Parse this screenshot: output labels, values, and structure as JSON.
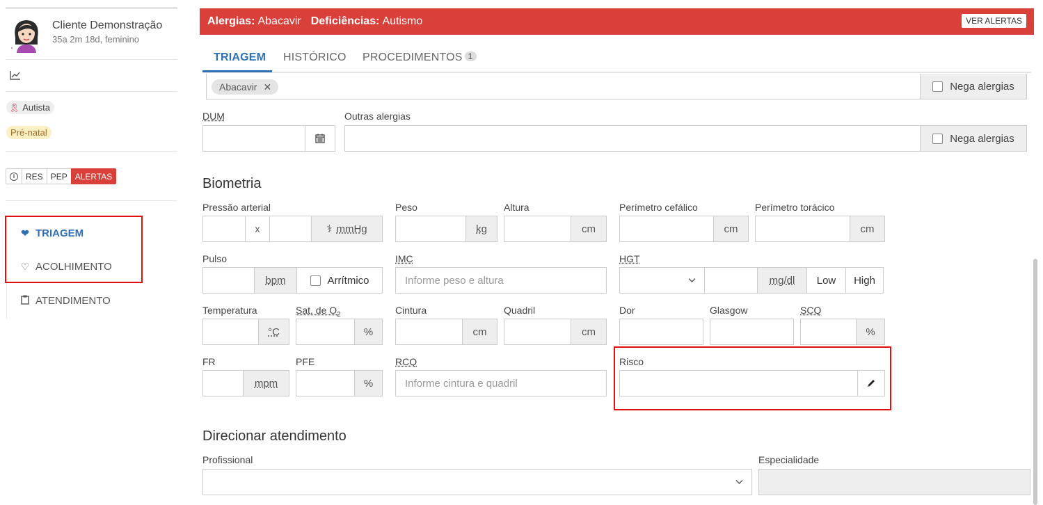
{
  "patient": {
    "name": "Cliente Demonstração",
    "meta": "35a 2m 18d, feminino"
  },
  "sidebar": {
    "tags": {
      "autista": "Autista",
      "prenatal": "Pré-natal"
    },
    "buttons": {
      "info": "i",
      "res": "RES",
      "pep": "PEP",
      "alertas": "ALERTAS"
    },
    "nav": [
      {
        "label": "TRIAGEM",
        "icon": "heartbeat-icon",
        "active": true
      },
      {
        "label": "ACOLHIMENTO",
        "icon": "heart-outline-icon"
      },
      {
        "label": "ATENDIMENTO",
        "icon": "clipboard-icon"
      }
    ]
  },
  "alert": {
    "alergias_label": "Alergias:",
    "alergias_value": "Abacavir",
    "deficiencias_label": "Deficiências:",
    "deficiencias_value": "Autismo",
    "ver_alertas": "VER ALERTAS"
  },
  "tabs": {
    "triagem": "TRIAGEM",
    "historico": "HISTÓRICO",
    "procedimentos": "PROCEDIMENTOS",
    "procedimentos_count": "1"
  },
  "alergias": {
    "chip": "Abacavir",
    "nega": "Nega alergias"
  },
  "dum": {
    "label": "DUM"
  },
  "outras": {
    "label": "Outras alergias",
    "nega": "Nega alergias"
  },
  "biometria": {
    "title": "Biometria",
    "pressao": {
      "label": "Pressão arterial",
      "sep": "x",
      "unit": "mmHg"
    },
    "peso": {
      "label": "Peso",
      "unit": "kg"
    },
    "altura": {
      "label": "Altura",
      "unit": "cm"
    },
    "cefalico": {
      "label": "Perímetro cefálico",
      "unit": "cm"
    },
    "toracico": {
      "label": "Perímetro torácico",
      "unit": "cm"
    },
    "pulso": {
      "label": "Pulso",
      "unit": "bpm",
      "arritmico": "Arrítmico"
    },
    "imc": {
      "label": "IMC",
      "placeholder": "Informe peso e altura"
    },
    "hgt": {
      "label": "HGT",
      "unit": "mg/dl",
      "low": "Low",
      "high": "High"
    },
    "temperatura": {
      "label": "Temperatura",
      "unit": "°C"
    },
    "sat": {
      "label": "Sat. de O",
      "sub": "2",
      "unit": "%"
    },
    "cintura": {
      "label": "Cintura",
      "unit": "cm"
    },
    "quadril": {
      "label": "Quadril",
      "unit": "cm"
    },
    "dor": {
      "label": "Dor"
    },
    "glasgow": {
      "label": "Glasgow"
    },
    "scq": {
      "label": "SCQ",
      "unit": "%"
    },
    "fr": {
      "label": "FR",
      "unit": "mpm"
    },
    "pfe": {
      "label": "PFE",
      "unit": "%"
    },
    "rcq": {
      "label": "RCQ",
      "placeholder": "Informe cintura e quadril"
    },
    "risco": {
      "label": "Risco"
    }
  },
  "direcionar": {
    "title": "Direcionar atendimento",
    "profissional": "Profissional",
    "especialidade": "Especialidade"
  }
}
